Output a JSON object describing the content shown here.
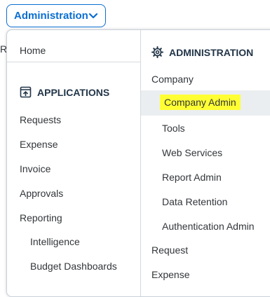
{
  "top_button": {
    "label": "Administration",
    "icon": "chevron-down-icon"
  },
  "edge_fragment": "R",
  "menu": {
    "left": {
      "home": "Home",
      "section_title": "APPLICATIONS",
      "section_icon": "applications-icon",
      "items": [
        "Requests",
        "Expense",
        "Invoice",
        "Approvals",
        "Reporting"
      ],
      "sub_items": [
        "Intelligence",
        "Budget Dashboards"
      ]
    },
    "right": {
      "section_title": "ADMINISTRATION",
      "section_icon": "gear-icon",
      "company": "Company",
      "company_items": [
        "Company Admin",
        "Tools",
        "Web Services",
        "Report Admin",
        "Data Retention",
        "Authentication Admin"
      ],
      "request": "Request",
      "expense": "Expense"
    }
  },
  "colors": {
    "accent": "#0a6ed1",
    "highlight": "#ffff33",
    "hover_row": "#ebeef0"
  }
}
